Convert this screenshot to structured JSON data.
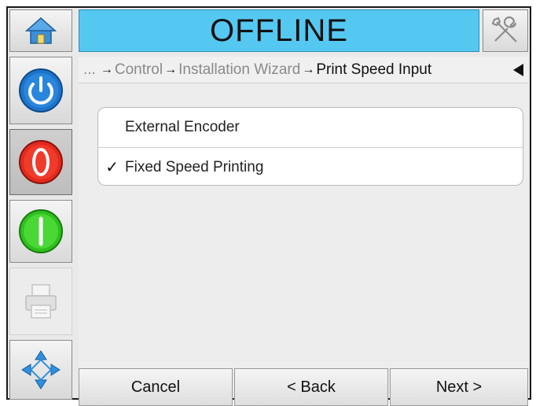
{
  "header": {
    "status": "OFFLINE",
    "status_color": "#55c8f2",
    "home_icon": "home-icon",
    "tools_icon": "tools-icon"
  },
  "sidebar": {
    "items": [
      {
        "name": "power-button",
        "icon": "power-icon",
        "color": "#1e74c8"
      },
      {
        "name": "stop-button",
        "icon": "stop-icon",
        "color": "#e02a1e",
        "selected": true
      },
      {
        "name": "start-button",
        "icon": "start-icon",
        "color": "#2fbf1f"
      },
      {
        "name": "print-button",
        "icon": "printer-icon",
        "disabled": true
      },
      {
        "name": "navigation-button",
        "icon": "navigation-arrows-icon",
        "color": "#2f8fe0"
      }
    ]
  },
  "breadcrumb": {
    "ellipsis": "...",
    "arrow": "→",
    "items": [
      "Control",
      "Installation Wizard",
      "Print Speed Input"
    ]
  },
  "options": [
    {
      "label": "External Encoder",
      "checked": false
    },
    {
      "label": "Fixed Speed Printing",
      "checked": true
    }
  ],
  "check_mark": "✓",
  "footer": {
    "cancel": "Cancel",
    "back": "< Back",
    "next": "Next >"
  }
}
